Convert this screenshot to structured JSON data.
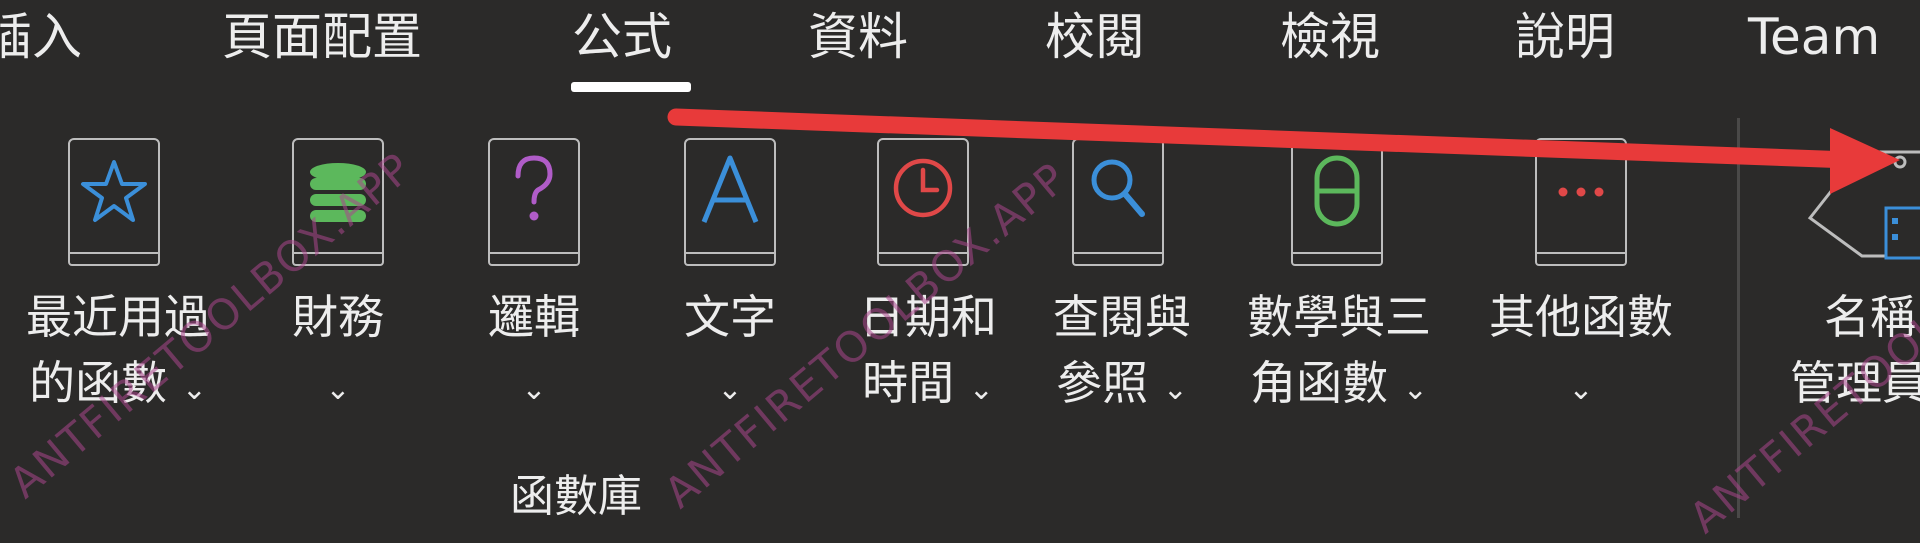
{
  "tabs": [
    {
      "key": "insert",
      "label": "插入"
    },
    {
      "key": "page_layout",
      "label": "頁面配置"
    },
    {
      "key": "formulas",
      "label": "公式",
      "active": true
    },
    {
      "key": "data",
      "label": "資料"
    },
    {
      "key": "review",
      "label": "校閱"
    },
    {
      "key": "view",
      "label": "檢視"
    },
    {
      "key": "help",
      "label": "說明"
    },
    {
      "key": "team",
      "label": "Team"
    }
  ],
  "commands": [
    {
      "key": "recent",
      "line1": "最近用過",
      "line2": "的函數",
      "icon": "star-icon",
      "color": "#3b8fd9"
    },
    {
      "key": "financial",
      "line1": "財務",
      "line2": "",
      "icon": "database-icon",
      "color": "#5cb85c"
    },
    {
      "key": "logical",
      "line1": "邏輯",
      "line2": "",
      "icon": "question-icon",
      "color": "#b05cc8"
    },
    {
      "key": "text",
      "line1": "文字",
      "line2": "",
      "icon": "letter-a-icon",
      "color": "#3b8fd9"
    },
    {
      "key": "datetime",
      "line1": "日期和",
      "line2": "時間",
      "icon": "clock-icon",
      "color": "#e04848"
    },
    {
      "key": "lookup",
      "line1": "查閱與",
      "line2": "參照",
      "icon": "magnifier-icon",
      "color": "#3b8fd9"
    },
    {
      "key": "math",
      "line1": "數學與三",
      "line2": "角函數",
      "icon": "theta-icon",
      "color": "#5cb85c"
    },
    {
      "key": "more",
      "line1": "其他函數",
      "line2": "",
      "icon": "ellipsis-icon",
      "color": "#e04848"
    },
    {
      "key": "name_manager",
      "line1": "名稱",
      "line2": "管理員",
      "icon": "name-tag-icon",
      "color": "#3b8fd9"
    }
  ],
  "group_label": "函數庫",
  "dropdown_glyph": "⌄",
  "watermark": "ANTFIRETOOLBOX.APP",
  "annotation_color": "#e83a3a"
}
